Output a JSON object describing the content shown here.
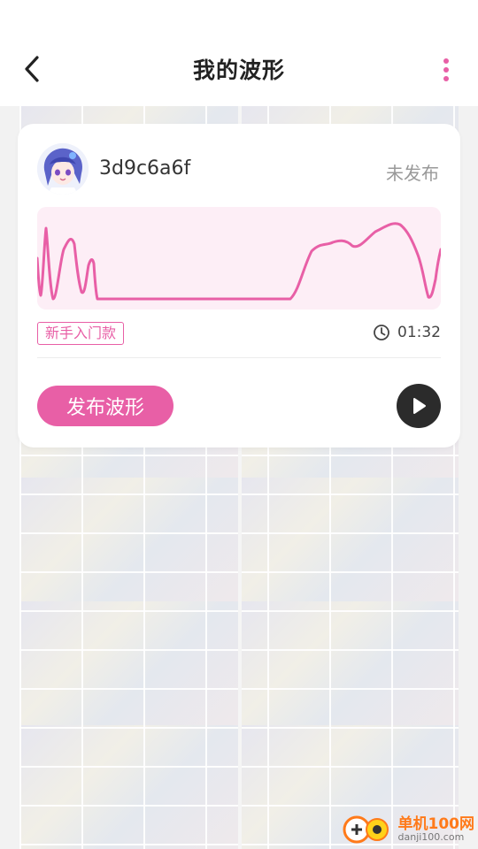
{
  "header": {
    "title": "我的波形"
  },
  "card": {
    "username": "3d9c6a6f",
    "status": "未发布",
    "tag": "新手入门款",
    "duration": "01:32",
    "publish_label": "发布波形",
    "waveform_color": "#e85fa6",
    "waveform_bg": "#fdeef6"
  },
  "colors": {
    "accent": "#e85fa6",
    "play_button": "#2b2b2b"
  },
  "watermark": {
    "name": "单机100网",
    "url": "danji100.com"
  },
  "icons": [
    "back-arrow-icon",
    "more-vertical-icon",
    "clock-icon",
    "play-icon"
  ]
}
